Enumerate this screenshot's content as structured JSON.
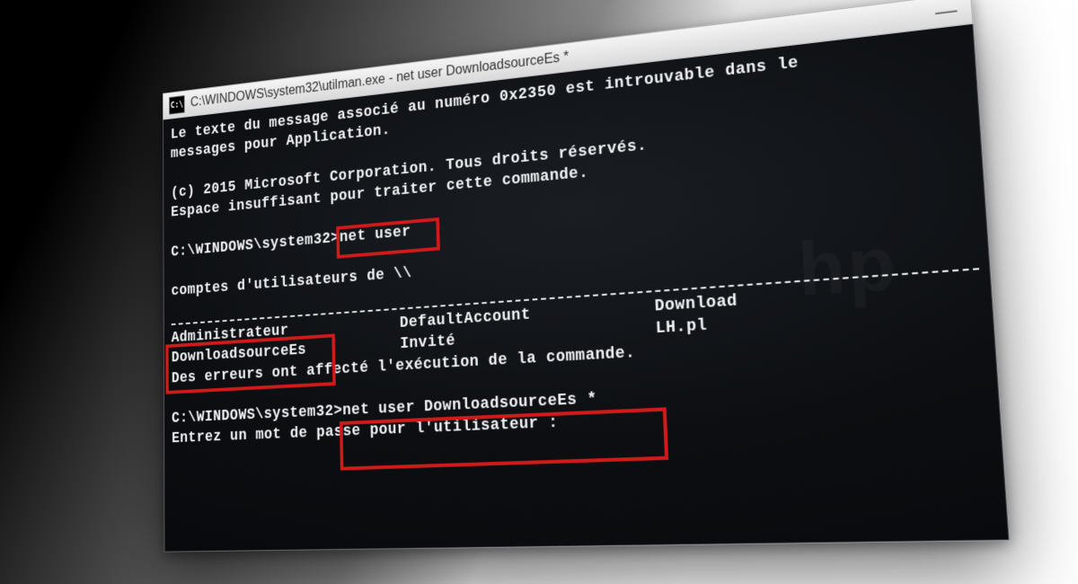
{
  "titlebar": {
    "icon_text": "C:\\",
    "title": "C:\\WINDOWS\\system32\\utilman.exe - net  user DownloadsourceEs *"
  },
  "lines": {
    "msg1": "Le texte du message associé au numéro 0x2350 est introuvable dans le",
    "msg2": "messages pour Application.",
    "copyright": "(c) 2015 Microsoft Corporation. Tous droits réservés.",
    "space_err": "Espace insuffisant pour traiter cette commande.",
    "prompt1_path": "C:\\WINDOWS\\system32>",
    "prompt1_cmd": "net user",
    "accounts_header": "comptes d'utilisateurs de \\\\",
    "col_a1": "Administrateur",
    "col_a2": "DownloadsourceEs",
    "col_b1": "DefaultAccount",
    "col_b2": "Invité",
    "col_c1": "Download",
    "col_c2": "LH.pl",
    "exec_err": "Des erreurs ont affecté l'exécution de la commande.",
    "prompt2_path": "C:\\WINDOWS\\system32>",
    "prompt2_cmd": "net user DownloadsourceEs *",
    "enter_pw": "Entrez un mot de passe pour l'utilisateur :"
  }
}
